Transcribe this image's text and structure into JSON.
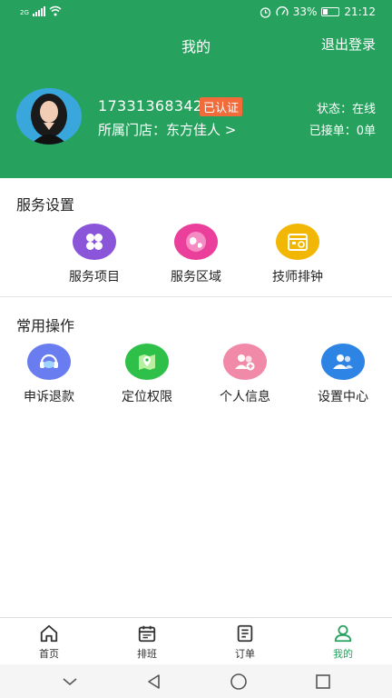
{
  "status_bar": {
    "network": "2G",
    "battery": "33%",
    "time": "21:12"
  },
  "header": {
    "title": "我的",
    "logout_label": "退出登录"
  },
  "profile": {
    "phone": "17331368342",
    "verified_badge": "已认证",
    "status_text": "状态：在线",
    "store_text": "所属门店：东方佳人 >",
    "orders_text": "已接单：0单"
  },
  "service_settings": {
    "title": "服务设置",
    "items": [
      {
        "label": "服务项目",
        "icon": "grid-icon",
        "color": "#8a55d9"
      },
      {
        "label": "服务区域",
        "icon": "globe-icon",
        "color": "#ea3f9a"
      },
      {
        "label": "技师排钟",
        "icon": "schedule-icon",
        "color": "#f2b705"
      }
    ]
  },
  "common_ops": {
    "title": "常用操作",
    "items": [
      {
        "label": "申诉退款",
        "icon": "support-icon",
        "color": "#6a7df0"
      },
      {
        "label": "定位权限",
        "icon": "map-icon",
        "color": "#2fc04a"
      },
      {
        "label": "个人信息",
        "icon": "user-add-icon",
        "color": "#f08aa8"
      },
      {
        "label": "设置中心",
        "icon": "users-icon",
        "color": "#2d84e5"
      }
    ]
  },
  "tabbar": {
    "items": [
      {
        "label": "首页",
        "icon": "home-icon"
      },
      {
        "label": "排班",
        "icon": "calendar-icon"
      },
      {
        "label": "订单",
        "icon": "document-icon"
      },
      {
        "label": "我的",
        "icon": "person-icon"
      }
    ],
    "active_color": "#27a25e"
  },
  "theme": {
    "primary": "#27a25e",
    "badge": "#f26b3a"
  }
}
